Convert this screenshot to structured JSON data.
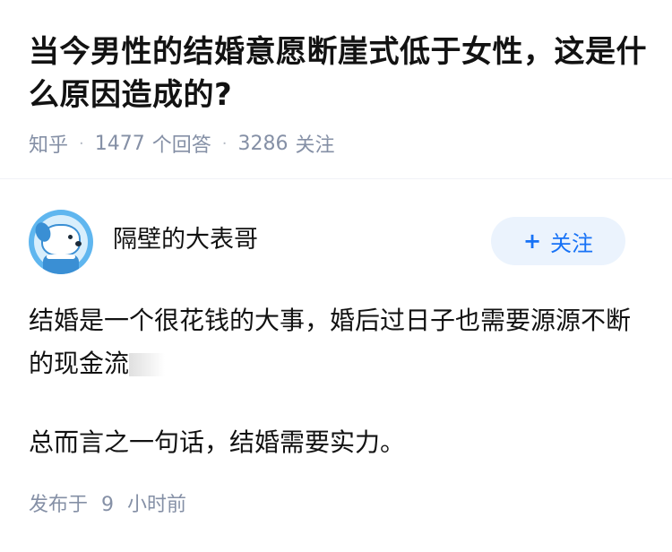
{
  "question": {
    "title": "当今男性的结婚意愿断崖式低于女性，这是什么原因造成的?",
    "source": "知乎",
    "answer_count": "1477",
    "answer_count_label": "个回答",
    "follower_count": "3286",
    "follower_count_label": "关注"
  },
  "answer": {
    "author": {
      "name": "隔壁的大表哥",
      "avatar_icon": "dog-avatar-icon"
    },
    "follow_button": {
      "plus": "+",
      "label": "关注"
    },
    "paragraphs": [
      "结婚是一个很花钱的大事，婚后过日子也需要源源不断的现金流",
      "总而言之一句话，结婚需要实力。"
    ],
    "publish": {
      "prefix": "发布于",
      "number": "9",
      "suffix": "小时前"
    }
  },
  "colors": {
    "accent": "#1772f6",
    "follow_button_bg": "#ebf3fd",
    "meta_text": "#8590a6",
    "title_text": "#121212"
  }
}
